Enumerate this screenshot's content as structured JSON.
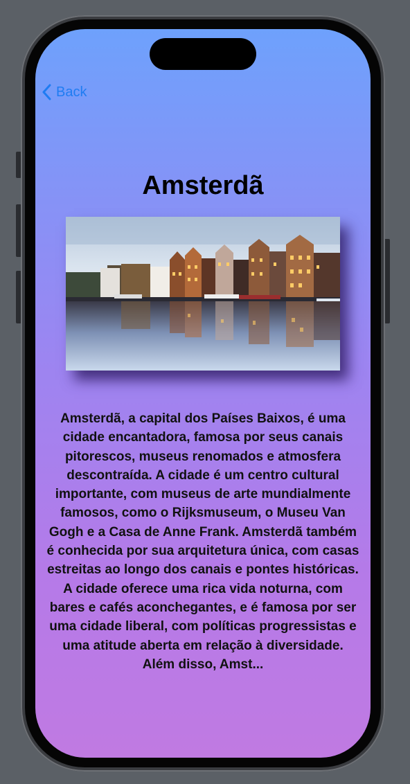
{
  "nav": {
    "back_label": "Back",
    "back_icon": "chevron-left-icon"
  },
  "city": {
    "title": "Amsterdã",
    "image_alt": "Amsterdam canal houses reflected in the water at dusk",
    "description": "Amsterdã, a capital dos Países Baixos, é uma cidade encantadora, famosa por seus canais pitorescos, museus renomados e atmosfera descontraída. A cidade é um centro cultural importante, com museus de arte mundialmente famosos, como o Rijksmuseum, o Museu Van Gogh e a Casa de Anne Frank. Amsterdã também é conhecida por sua arquitetura única, com casas estreitas ao longo dos canais e pontes históricas. A cidade oferece uma rica vida noturna, com bares e cafés aconchegantes, e é famosa por ser uma cidade liberal, com políticas progressistas e uma atitude aberta em relação à diversidade. Além disso, Amst..."
  },
  "colors": {
    "accent": "#1f7cf2",
    "gradient_top": "#6ea1fc",
    "gradient_bottom": "#c07ae2"
  }
}
